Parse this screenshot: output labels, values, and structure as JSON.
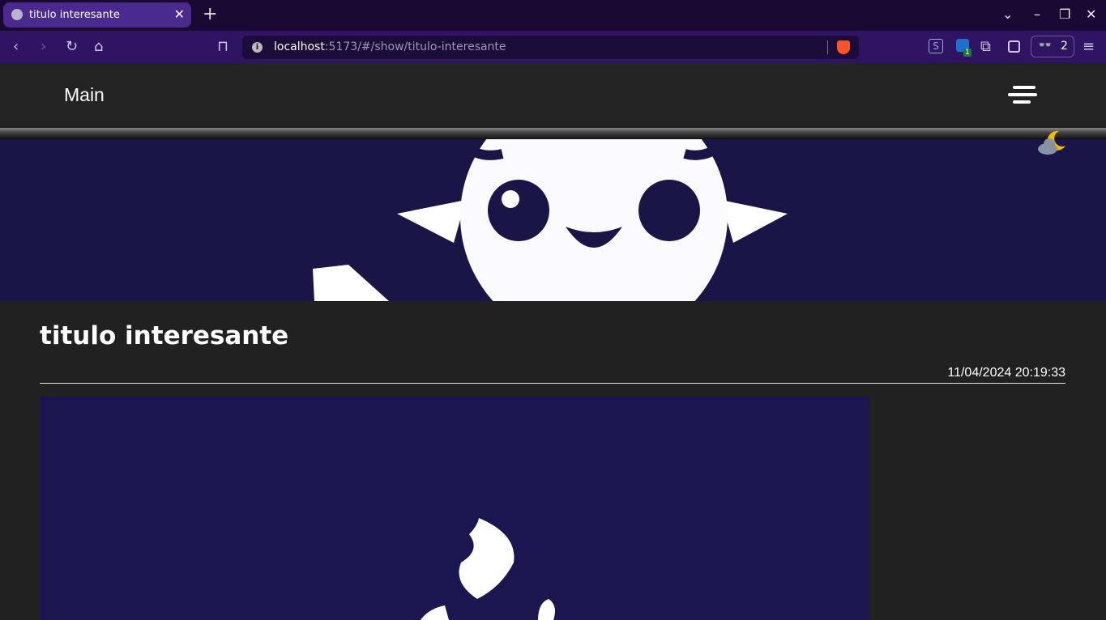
{
  "browser": {
    "tab_title": "titulo interesante",
    "url_host": "localhost",
    "url_path": ":5173/#/show/titulo-interesante",
    "extension_badge": "1",
    "reader_count": "2"
  },
  "page": {
    "brand": "Main",
    "post_title": "titulo interesante",
    "post_date": "11/04/2024 20:19:33"
  },
  "colors": {
    "accent": "#4a2a8e",
    "hero_bg": "#1a1547",
    "page_bg": "#212121"
  }
}
